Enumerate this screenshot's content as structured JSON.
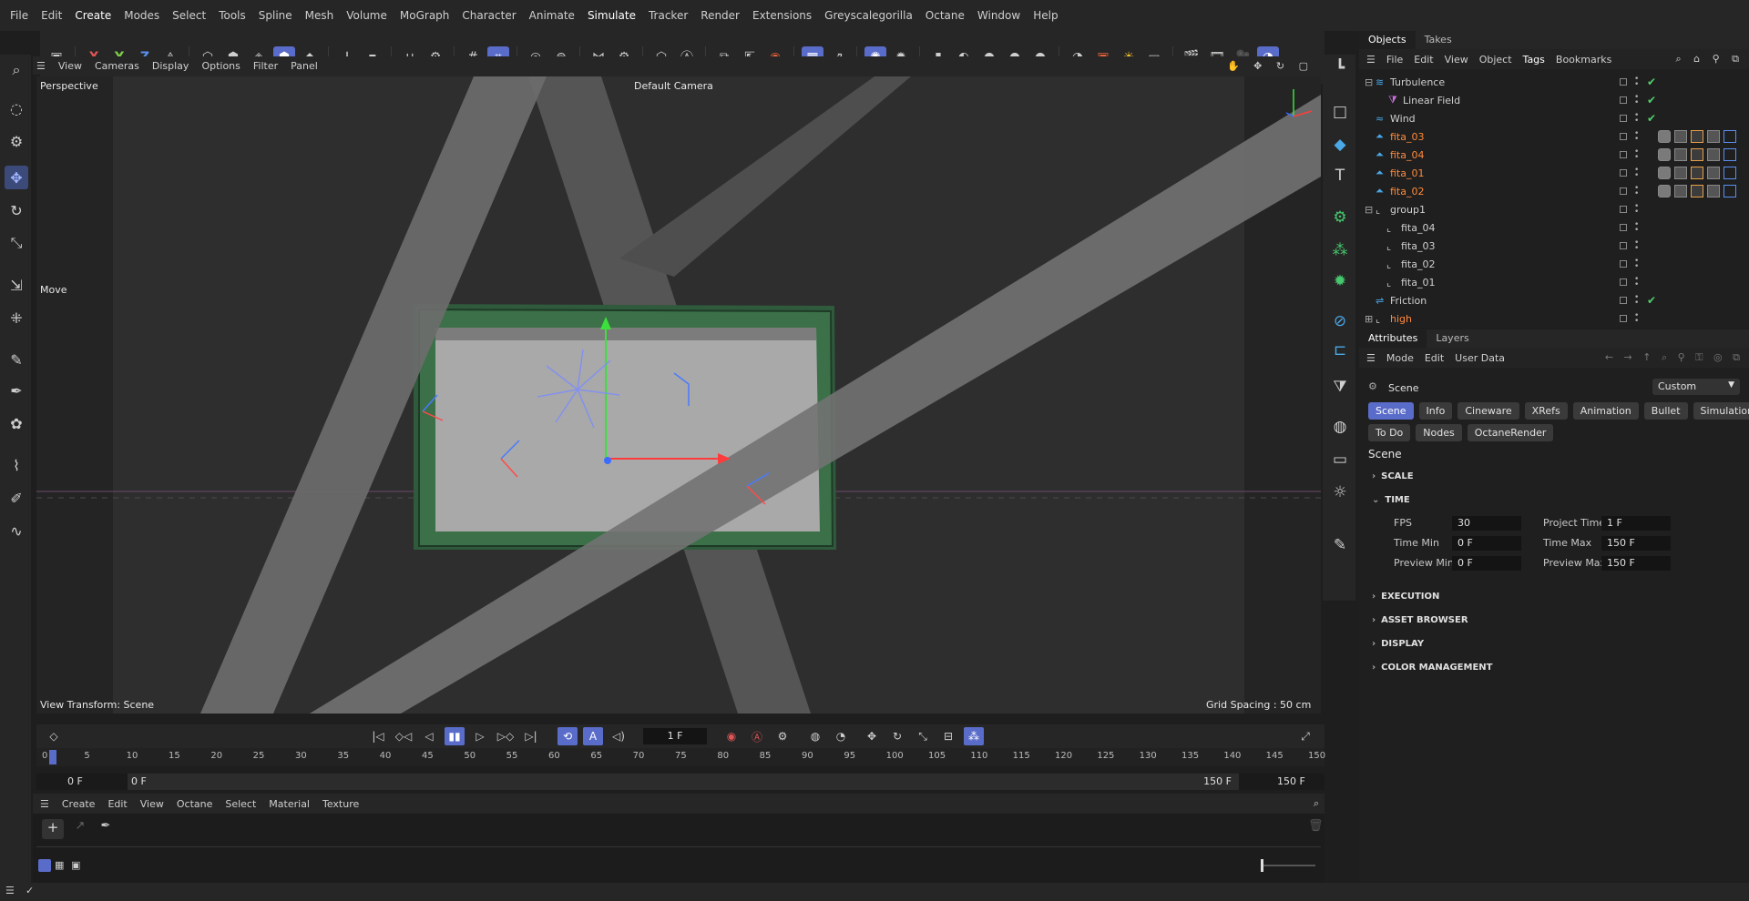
{
  "menu": [
    "File",
    "Edit",
    "Create",
    "Modes",
    "Select",
    "Tools",
    "Spline",
    "Mesh",
    "Volume",
    "MoGraph",
    "Character",
    "Animate",
    "Simulate",
    "Tracker",
    "Render",
    "Extensions",
    "Greyscalegorilla",
    "Octane",
    "Window",
    "Help"
  ],
  "toolbar_axes": {
    "x": "X",
    "y": "Y",
    "z": "Z"
  },
  "viewport": {
    "menu": [
      "View",
      "Cameras",
      "Display",
      "Options",
      "Filter",
      "Panel"
    ],
    "mode": "Perspective",
    "camera": "Default Camera",
    "tool_label": "Move",
    "transform": "View Transform: Scene",
    "grid": "Grid Spacing : 50 cm"
  },
  "objects": {
    "tabs": [
      "Objects",
      "Takes"
    ],
    "menu": [
      "File",
      "Edit",
      "View",
      "Object",
      "Tags",
      "Bookmarks"
    ],
    "rows": [
      {
        "name": "Turbulence",
        "check": "✔"
      },
      {
        "name": "Linear Field",
        "check": "✔"
      },
      {
        "name": "Wind",
        "check": "✔"
      },
      {
        "name": "fita_03"
      },
      {
        "name": "fita_04"
      },
      {
        "name": "fita_01"
      },
      {
        "name": "fita_02"
      },
      {
        "name": "group1"
      },
      {
        "name": "fita_04"
      },
      {
        "name": "fita_03"
      },
      {
        "name": "fita_02"
      },
      {
        "name": "fita_01"
      },
      {
        "name": "Friction",
        "check": "✔"
      },
      {
        "name": "high"
      }
    ]
  },
  "attributes": {
    "tabs": [
      "Attributes",
      "Layers"
    ],
    "menu": [
      "Mode",
      "Edit",
      "User Data"
    ],
    "object": "Scene",
    "preset": "Custom",
    "buttons_row1": [
      "Scene",
      "Info",
      "Cineware",
      "XRefs",
      "Animation",
      "Bullet",
      "Simulation"
    ],
    "buttons_row2": [
      "To Do",
      "Nodes",
      "OctaneRender"
    ],
    "heading": "Scene",
    "sections": [
      "SCALE",
      "TIME",
      "EXECUTION",
      "ASSET BROWSER",
      "DISPLAY",
      "COLOR MANAGEMENT"
    ],
    "time": {
      "fps_label": "FPS",
      "fps": "30",
      "project_time_label": "Project Time",
      "project_time": "1 F",
      "time_min_label": "Time Min",
      "time_min": "0 F",
      "time_max_label": "Time Max",
      "time_max": "150 F",
      "preview_min_label": "Preview Min",
      "preview_min": "0 F",
      "preview_max_label": "Preview Max",
      "preview_max": "150 F"
    }
  },
  "timeline": {
    "current_frame": "1 F",
    "ticks": [
      "0",
      "5",
      "10",
      "15",
      "20",
      "25",
      "30",
      "35",
      "40",
      "45",
      "50",
      "55",
      "60",
      "65",
      "70",
      "75",
      "80",
      "85",
      "90",
      "95",
      "100",
      "105",
      "110",
      "115",
      "120",
      "125",
      "130",
      "135",
      "140",
      "145",
      "150"
    ],
    "range_start": "0 F",
    "range_start_inner": "0 F",
    "range_end_inner": "150 F",
    "range_end": "150 F"
  },
  "material": {
    "menu": [
      "Create",
      "Edit",
      "View",
      "Octane",
      "Select",
      "Material",
      "Texture"
    ]
  },
  "colors": {
    "accent": "#5a6cc9",
    "orange": "#ff8a3c",
    "green": "#4fd06a"
  }
}
